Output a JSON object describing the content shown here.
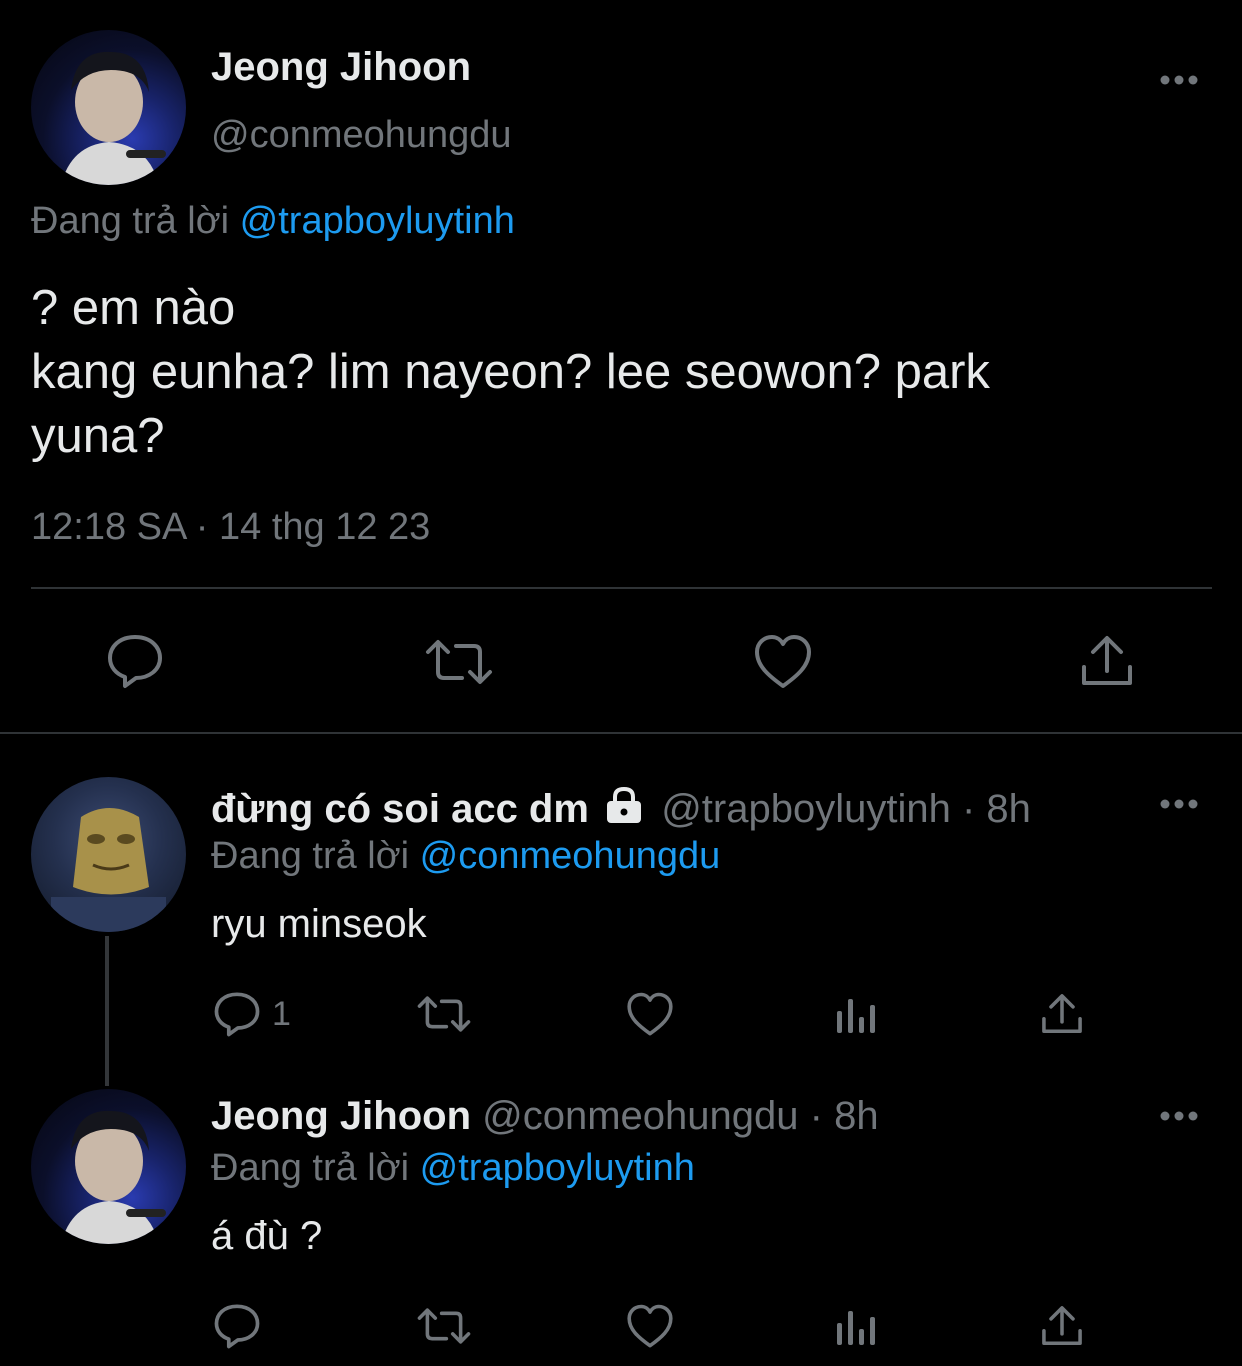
{
  "main_tweet": {
    "author_name": "Jeong Jihoon",
    "author_handle": "@conmeohungdu",
    "replying_prefix": "Đang trả lời",
    "replying_to": "@trapboyluytinh",
    "text_line1": "? em nào",
    "text_line2": "kang eunha? lim nayeon? lee seowon? park",
    "text_line3": "yuna?",
    "timestamp": "12:18 SA · 14 thg 12 23"
  },
  "reply1": {
    "author_name": "đừng có soi acc dm",
    "author_handle": "@trapboyluytinh",
    "time": "· 8h",
    "replying_prefix": "Đang trả lời",
    "replying_to": "@conmeohungdu",
    "text": "ryu minseok",
    "reply_count": "1"
  },
  "reply2": {
    "author_name": "Jeong Jihoon",
    "author_handle": "@conmeohungdu",
    "time": "· 8h",
    "replying_prefix": "Đang trả lời",
    "replying_to": "@trapboyluytinh",
    "text": "á đù ?"
  },
  "colors": {
    "background": "#000000",
    "text": "#e7e9ea",
    "secondary": "#71767b",
    "link": "#1d9bf0",
    "divider": "#2f3336"
  },
  "icons": [
    "more-icon",
    "reply-icon",
    "retweet-icon",
    "like-icon",
    "share-icon",
    "views-icon",
    "lock-icon"
  ]
}
